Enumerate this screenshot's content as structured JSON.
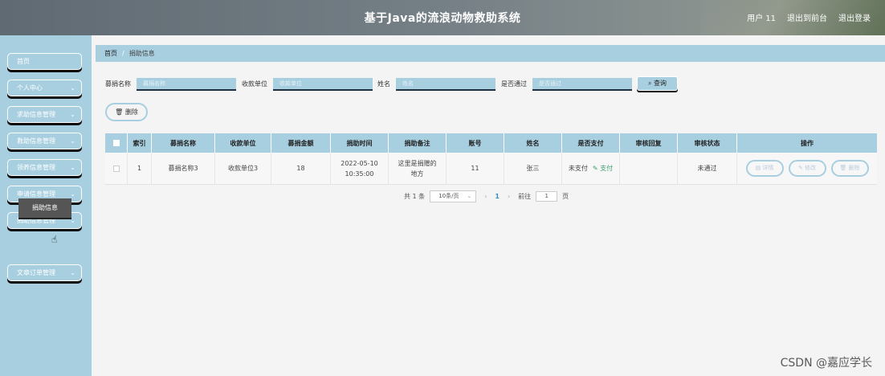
{
  "header": {
    "title": "基于Java的流浪动物救助系统",
    "user": "用户 11",
    "frontend_link": "退出到前台",
    "logout_link": "退出登录"
  },
  "sidebar": {
    "items": [
      {
        "label": "首页"
      },
      {
        "label": "个人中心"
      },
      {
        "label": "求助信息管理"
      },
      {
        "label": "救助信息管理"
      },
      {
        "label": "领养信息管理"
      },
      {
        "label": "申请信息管理"
      },
      {
        "label": "捐助信息管理"
      },
      {
        "label": "文章订单管理"
      }
    ],
    "sub_item": "捐助信息"
  },
  "breadcrumb": {
    "home": "首页",
    "current": "捐助信息"
  },
  "search": {
    "fields": [
      {
        "label": "募捐名称",
        "placeholder": "募捐名称"
      },
      {
        "label": "收款单位",
        "placeholder": "收款单位"
      },
      {
        "label": "姓名",
        "placeholder": "姓名"
      },
      {
        "label": "是否通过",
        "placeholder": "是否通过"
      }
    ],
    "button": "查询",
    "button_icon": "search-icon"
  },
  "delete_button": "删除",
  "table": {
    "columns": [
      "索引",
      "募捐名称",
      "收款单位",
      "募捐金额",
      "捐助时间",
      "捐助备注",
      "账号",
      "姓名",
      "是否支付",
      "审核回复",
      "审核状态",
      "操作"
    ],
    "rows": [
      {
        "index": "1",
        "name": "募捐名称3",
        "unit": "收款单位3",
        "amount": "18",
        "time": "2022-05-10 10:35:00",
        "remark": "这里是捐赠的地方",
        "account": "11",
        "person": "张三",
        "paid": "未支付",
        "pay_action": "支付",
        "reply": "",
        "status": "未通过",
        "actions": [
          "详情",
          "修改",
          "删除"
        ]
      }
    ]
  },
  "pagination": {
    "total": "共 1 条",
    "page_size": "10条/页",
    "current_page": "1",
    "goto_label": "前往",
    "goto_value": "1",
    "page_suffix": "页"
  },
  "watermark": "CSDN @嘉应学长"
}
